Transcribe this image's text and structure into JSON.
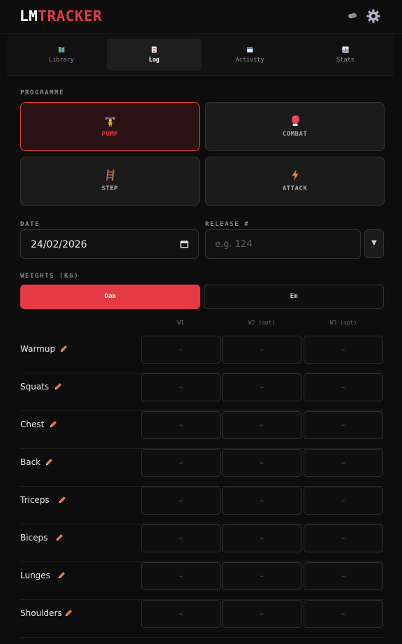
{
  "app": {
    "title_part1": "LM",
    "title_part2": "TRACKER"
  },
  "colors": {
    "accent": "#e63946",
    "background": "#0d0d0d",
    "panel": "#1b1b1b"
  },
  "header": {
    "icons": [
      "cloud-icon",
      "gear-icon"
    ]
  },
  "tabs": [
    {
      "label": "Library",
      "icon": "books-icon"
    },
    {
      "label": "Log",
      "icon": "memo-icon",
      "active": true
    },
    {
      "label": "Activity",
      "icon": "calendar-icon"
    },
    {
      "label": "Stats",
      "icon": "bar-chart-icon"
    }
  ],
  "programme": {
    "label": "PROGRAMME",
    "options": [
      {
        "label": "PUMP",
        "icon": "dumbbell-icon",
        "active": true
      },
      {
        "label": "COMBAT",
        "icon": "boxing-glove-icon"
      },
      {
        "label": "STEP",
        "icon": "ladder-icon"
      },
      {
        "label": "ATTACK",
        "icon": "lightning-icon"
      }
    ]
  },
  "date": {
    "label": "DATE",
    "value": "24/02/2026"
  },
  "release": {
    "label": "RELEASE #",
    "placeholder": "e.g. 124"
  },
  "weights": {
    "label": "WEIGHTS (KG)",
    "people": [
      {
        "label": "Dan",
        "active": true
      },
      {
        "label": "Em"
      }
    ],
    "columns": [
      "W1",
      "W2 (opt)",
      "W3 (opt)"
    ],
    "empty_value": "–",
    "exercises": [
      "Warmup",
      "Squats",
      "Chest",
      "Back",
      "Triceps",
      "Biceps",
      "Lunges",
      "Shoulders"
    ]
  }
}
